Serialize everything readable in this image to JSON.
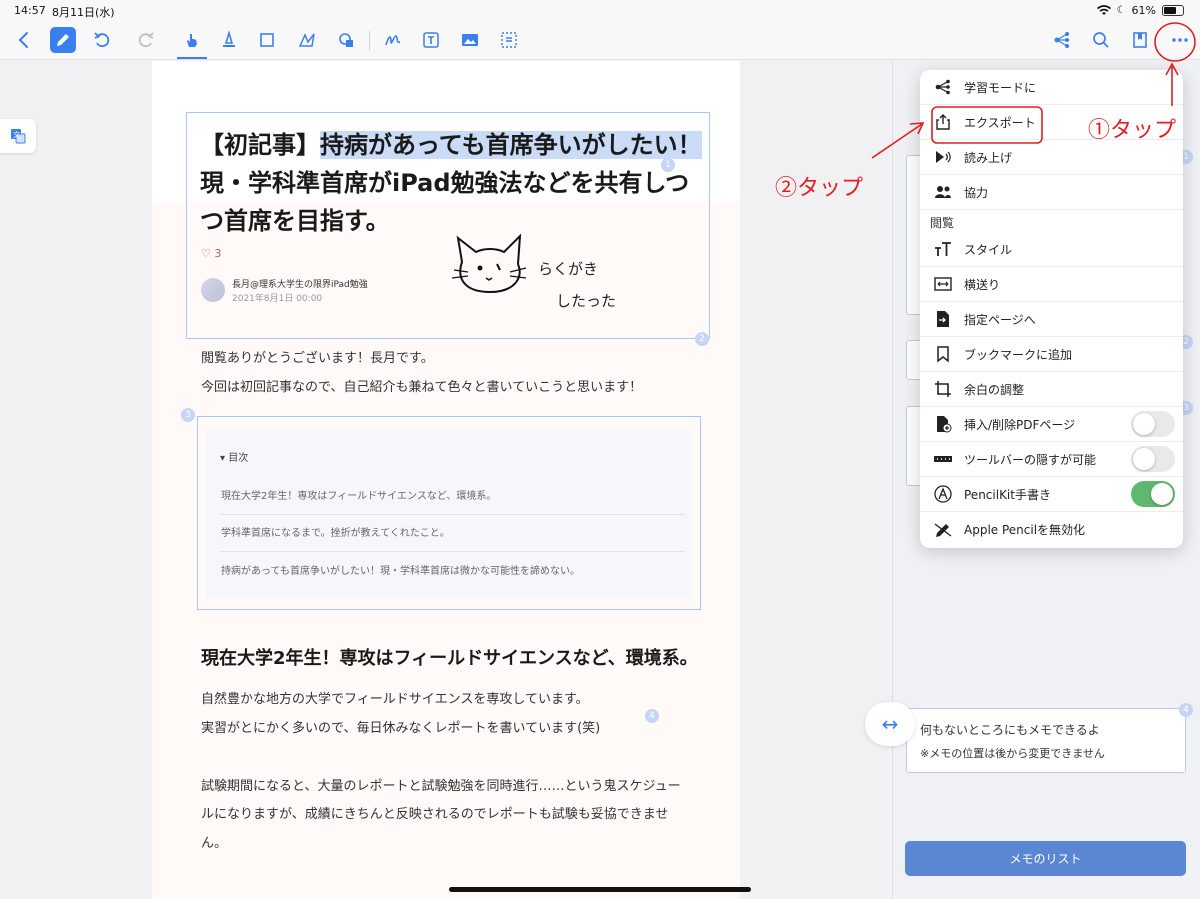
{
  "status_bar": {
    "time": "14:57",
    "date": "8月11日(水)",
    "battery": "61%"
  },
  "toolbar": {
    "icons": [
      "back-icon",
      "pen-icon",
      "undo-icon",
      "redo-icon",
      "hand-icon",
      "highlighter-icon",
      "rectangle-icon",
      "lasso-icon",
      "shape-icon",
      "handwriting-icon",
      "text-icon",
      "image-icon",
      "select-icon",
      "share-graph-icon",
      "search-icon",
      "bookmark-icon",
      "more-icon"
    ],
    "accent": "#3a7ff0"
  },
  "article": {
    "title_prefix": "【初記事】",
    "title_selected": "持病があっても首席争いがしたい！",
    "title_rest": "現・学科準首席がiPad勉強法などを共有しつつ首席を目指す。",
    "likes": "3",
    "author": "長月@理系大学生の限界iPad勉強",
    "date": "2021年8月1日 00:00",
    "doodle_line1": "らくがき",
    "doodle_line2": "したった",
    "intro_1": "閲覧ありがとうございます！長月です。",
    "intro_2": "今回は初回記事なので、自己紹介も兼ねて色々と書いていこうと思います！",
    "toc_heading": "目次",
    "toc_items": [
      "現在大学2年生！専攻はフィールドサイエンスなど、環境系。",
      "学科準首席になるまで。挫折が教えてくれたこと。",
      "持病があっても首席争いがしたい！現・学科準首席は微かな可能性を諦めない。"
    ],
    "section_heading": "現在大学2年生！専攻はフィールドサイエンスなど、環境系。",
    "body_1": "自然豊かな地方の大学でフィールドサイエンスを専攻しています。",
    "body_2": "実習がとにかく多いので、毎日休みなくレポートを書いています(笑)",
    "body_3": "試験期間になると、大量のレポートと試験勉強を同時進行……という鬼スケジュー",
    "body_4": "ルになりますが、成績にきちんと反映されるのでレポートも試験も妥協できませ",
    "body_5": "ん。",
    "markers": [
      "1",
      "2",
      "3",
      "4"
    ]
  },
  "menu": {
    "items": [
      {
        "label": "学習モードに",
        "icon": "graph-icon"
      },
      {
        "label": "エクスポート",
        "icon": "export-icon"
      },
      {
        "label": "読み上げ",
        "icon": "speak-icon"
      },
      {
        "label": "協力",
        "icon": "people-icon"
      }
    ],
    "section": "閲覧",
    "items2": [
      {
        "label": "スタイル",
        "icon": "text-size-icon"
      },
      {
        "label": "横送り",
        "icon": "horizontal-scroll-icon"
      },
      {
        "label": "指定ページへ",
        "icon": "goto-page-icon"
      },
      {
        "label": "ブックマークに追加",
        "icon": "bookmark-icon"
      },
      {
        "label": "余白の調整",
        "icon": "crop-icon"
      },
      {
        "label": "挿入/削除PDFページ",
        "icon": "pdf-page-icon",
        "toggle": false
      },
      {
        "label": "ツールバーの隠すが可能",
        "icon": "toolbar-icon",
        "toggle": false
      },
      {
        "label": "PencilKit手書き",
        "icon": "pencilkit-icon",
        "toggle": true
      },
      {
        "label": "Apple Pencilを無効化",
        "icon": "pencil-off-icon"
      }
    ]
  },
  "memo": {
    "note_1": "何もないところにもメモできるよ",
    "note_2": "※メモの位置は後から変更できません",
    "list_button": "メモのリスト",
    "markers": [
      "1",
      "2",
      "3",
      "4"
    ]
  },
  "annotations": {
    "tap_1": "①タップ",
    "tap_2": "②タップ"
  }
}
